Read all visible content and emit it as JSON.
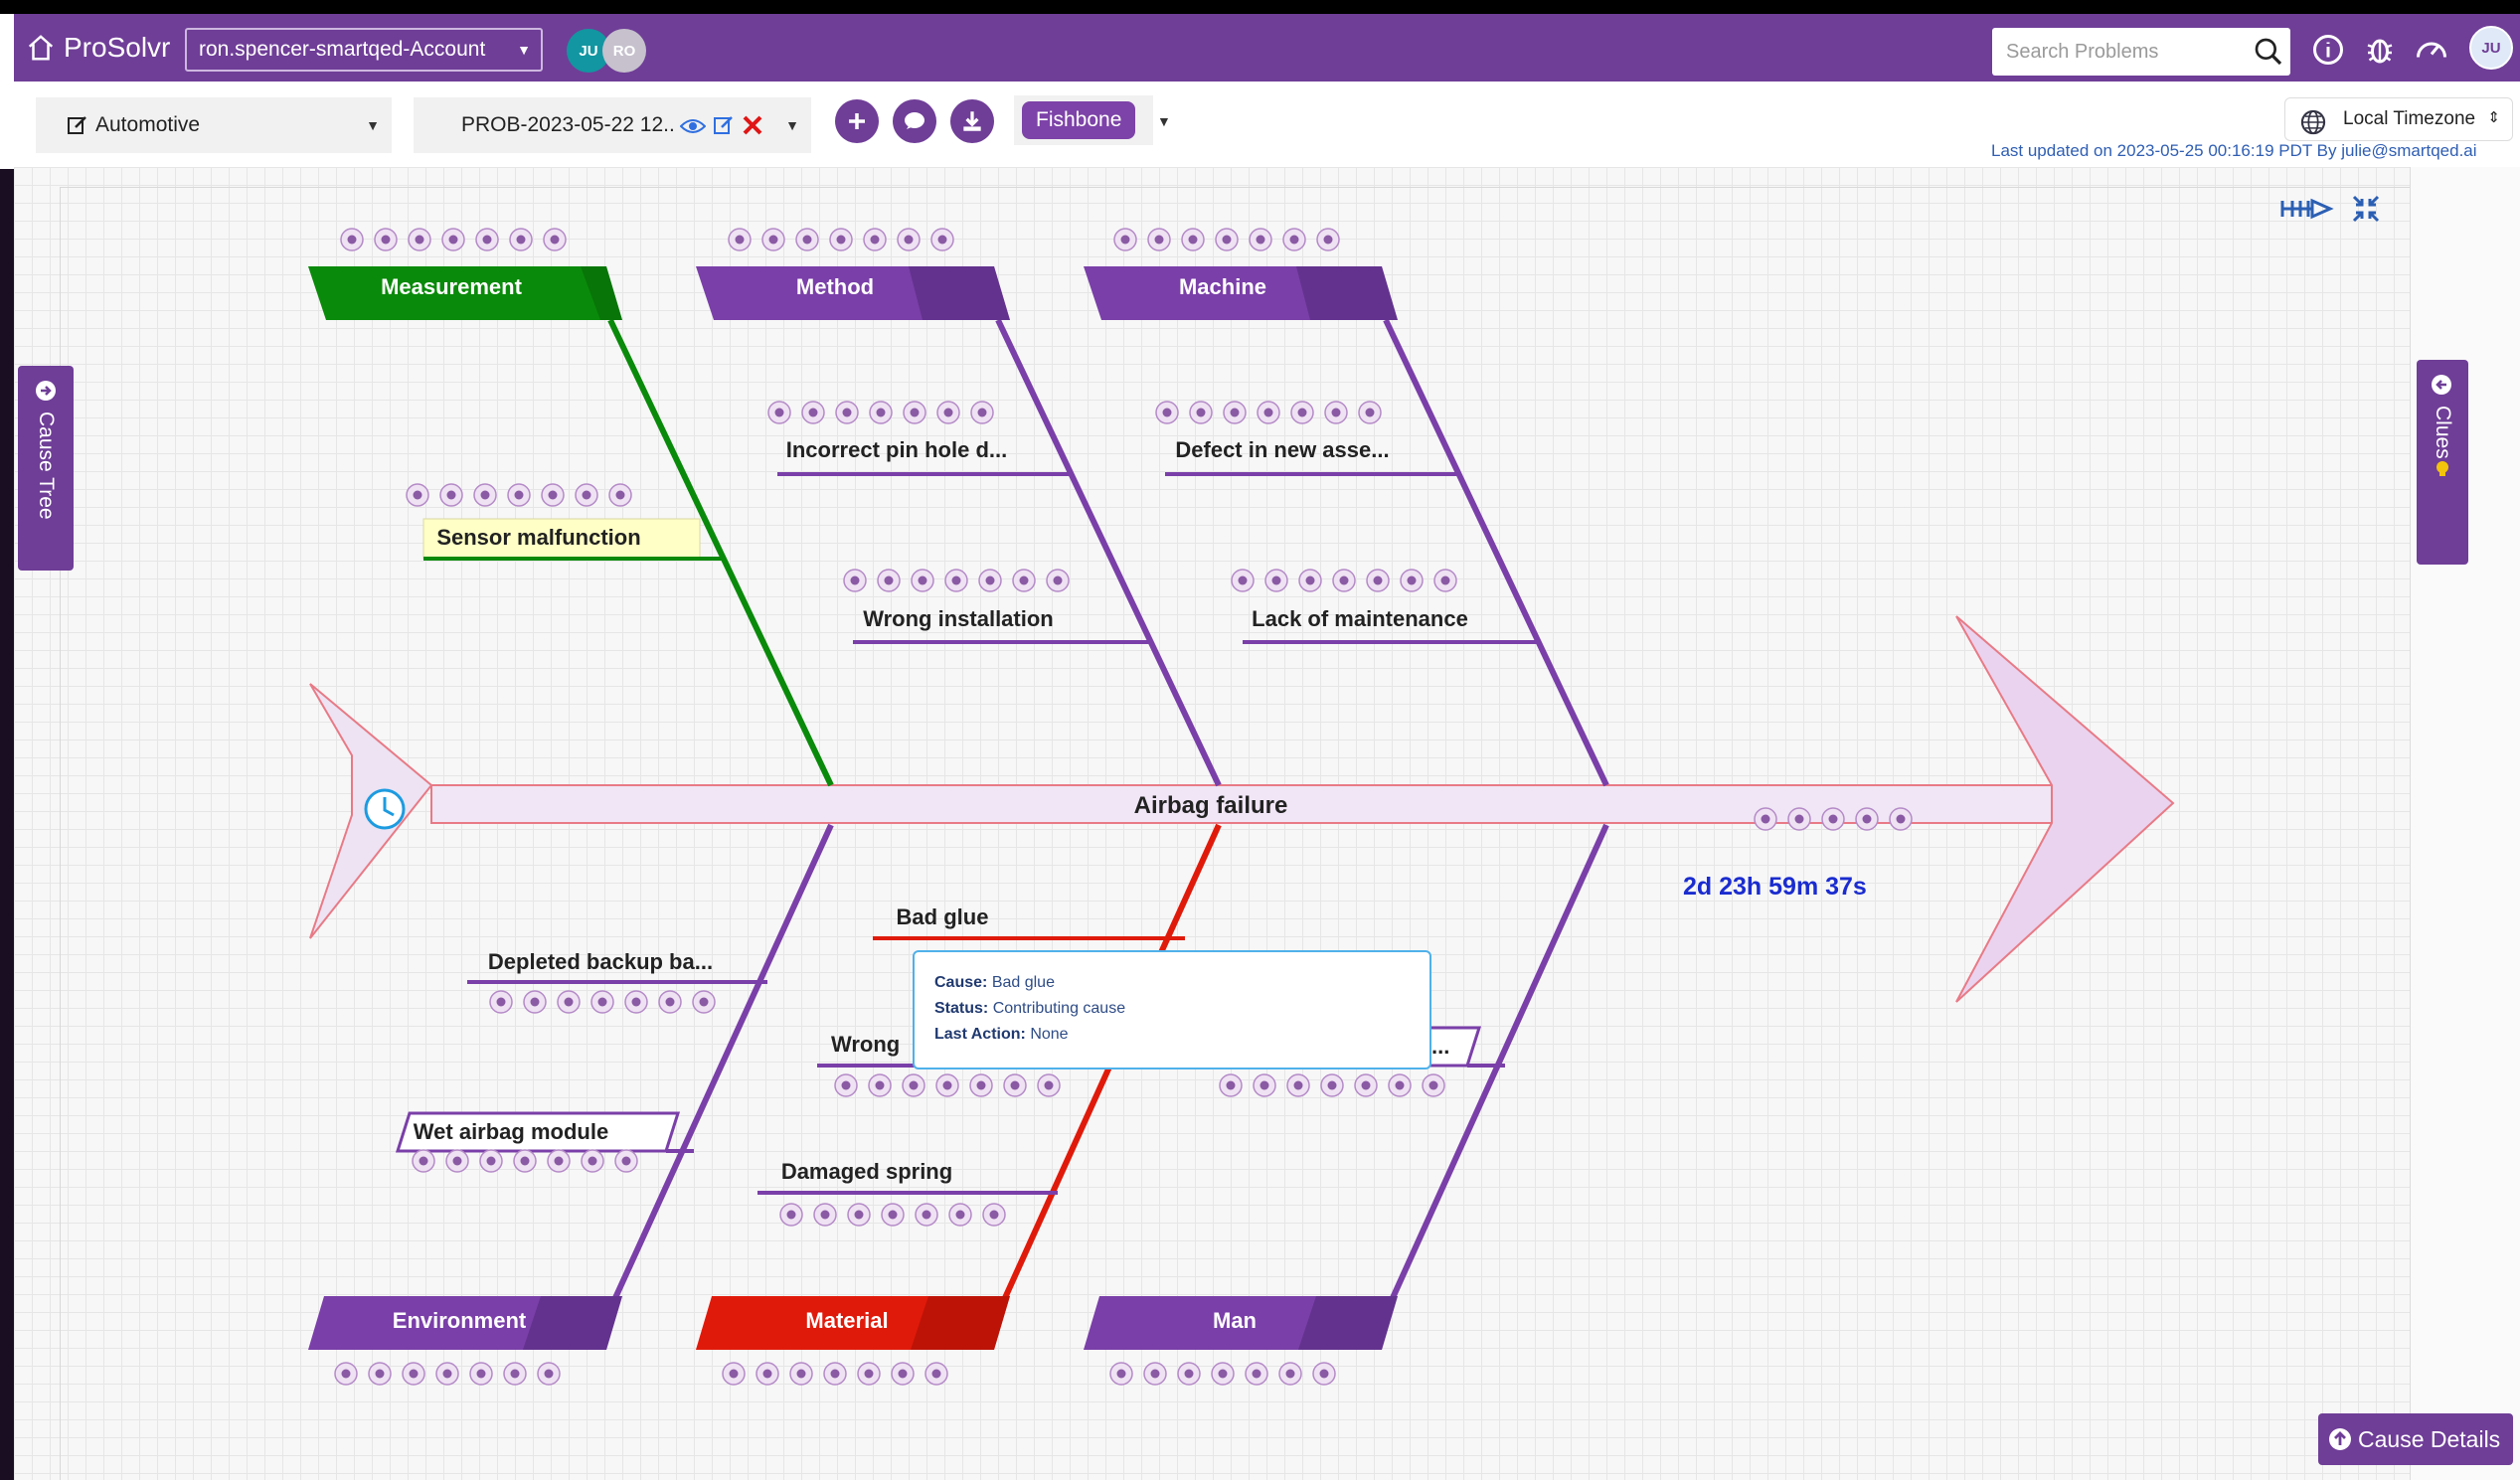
{
  "app": {
    "brand": "ProSolvr",
    "account": "ron.spencer-smartqed-Account",
    "avatars": [
      "JU",
      "RO"
    ],
    "user_avatar": "JU",
    "search_placeholder": "Search Problems"
  },
  "toolbar": {
    "industry": "Automotive",
    "problem": "PROB-2023-05-22 12..",
    "view": "Fishbone",
    "timezone": "Local Timezone",
    "last_updated": "Last updated on 2023-05-25 00:16:19 PDT By julie@smartqed.ai"
  },
  "side_tabs": {
    "cause_tree": "Cause Tree",
    "clues": "Clues",
    "cause_details": "Cause Details"
  },
  "fishbone": {
    "problem": "Airbag failure",
    "timer": "2d 23h 59m 37s",
    "categories": [
      {
        "label": "Measurement",
        "color": "#0a8a0a"
      },
      {
        "label": "Method",
        "color": "#7a3fa8"
      },
      {
        "label": "Machine",
        "color": "#7a3fa8"
      },
      {
        "label": "Environment",
        "color": "#7a3fa8"
      },
      {
        "label": "Material",
        "color": "#e01a0a"
      },
      {
        "label": "Man",
        "color": "#7a3fa8"
      }
    ],
    "causes": [
      "Sensor malfunction",
      "Incorrect pin hole d...",
      "Wrong installation",
      "Defect in new asse...",
      "Lack of maintenance",
      "Depleted backup ba...",
      "Wet airbag module",
      "Bad glue",
      "Wrong",
      "Damaged spring",
      "..."
    ]
  },
  "tooltip": {
    "cause_label": "Cause:",
    "cause_value": "Bad glue",
    "status_label": "Status:",
    "status_value": "Contributing cause",
    "action_label": "Last Action:",
    "action_value": "None"
  }
}
